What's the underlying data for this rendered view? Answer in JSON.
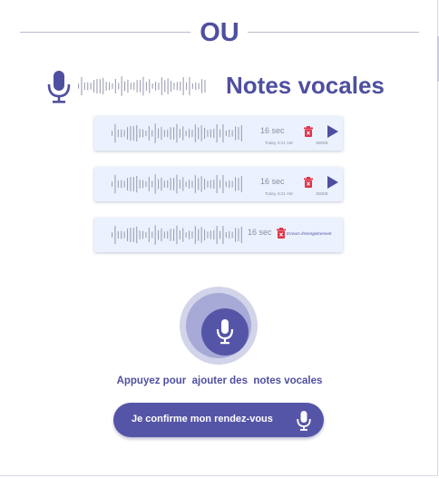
{
  "divider": {
    "text": "OU"
  },
  "header": {
    "title": "Notes vocales",
    "mic_icon": "microphone-icon",
    "wave_icon": "waveform-icon"
  },
  "notes": [
    {
      "duration": "16 sec",
      "date": "Today, 8:21 AM",
      "size": "350KB",
      "status": "ok"
    },
    {
      "duration": "16 sec",
      "date": "Today, 8:21 AM",
      "size": "350KB",
      "status": "ok"
    },
    {
      "duration": "16 sec",
      "error": "Erreurs d'enregistrement",
      "status": "error"
    }
  ],
  "record": {
    "hint": "Appuyez pour  ajouter des  notes vocales",
    "icon": "microphone-icon"
  },
  "confirm": {
    "label": "Je confirme mon rendez-vous",
    "icon": "microphone-icon"
  },
  "colors": {
    "primary": "#4f4fa1",
    "button": "#5555a8",
    "card": "#ebf2fd",
    "trash": "#e0344a",
    "ring_outer": "#d2d4ea",
    "ring_mid": "#a7a9d6"
  }
}
